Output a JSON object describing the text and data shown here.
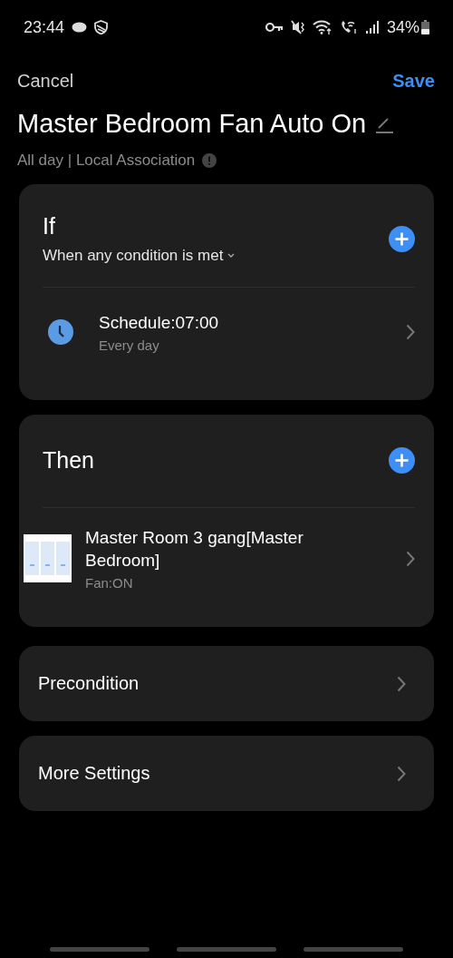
{
  "status_bar": {
    "time": "23:44",
    "battery": "34%"
  },
  "header": {
    "cancel": "Cancel",
    "save": "Save",
    "title": "Master Bedroom Fan Auto On",
    "subtitle": "All day | Local Association"
  },
  "sections": [
    {
      "title": "If",
      "match": "When any condition is met",
      "items": [
        {
          "kind": "schedule",
          "title": "Schedule:07:00",
          "subtitle": "Every day"
        }
      ]
    },
    {
      "title": "Then",
      "items": [
        {
          "kind": "device",
          "title": "Master Room 3 gang[Master Bedroom]",
          "subtitle": "Fan:ON"
        }
      ]
    }
  ],
  "rows": [
    "Precondition",
    "More Settings"
  ]
}
